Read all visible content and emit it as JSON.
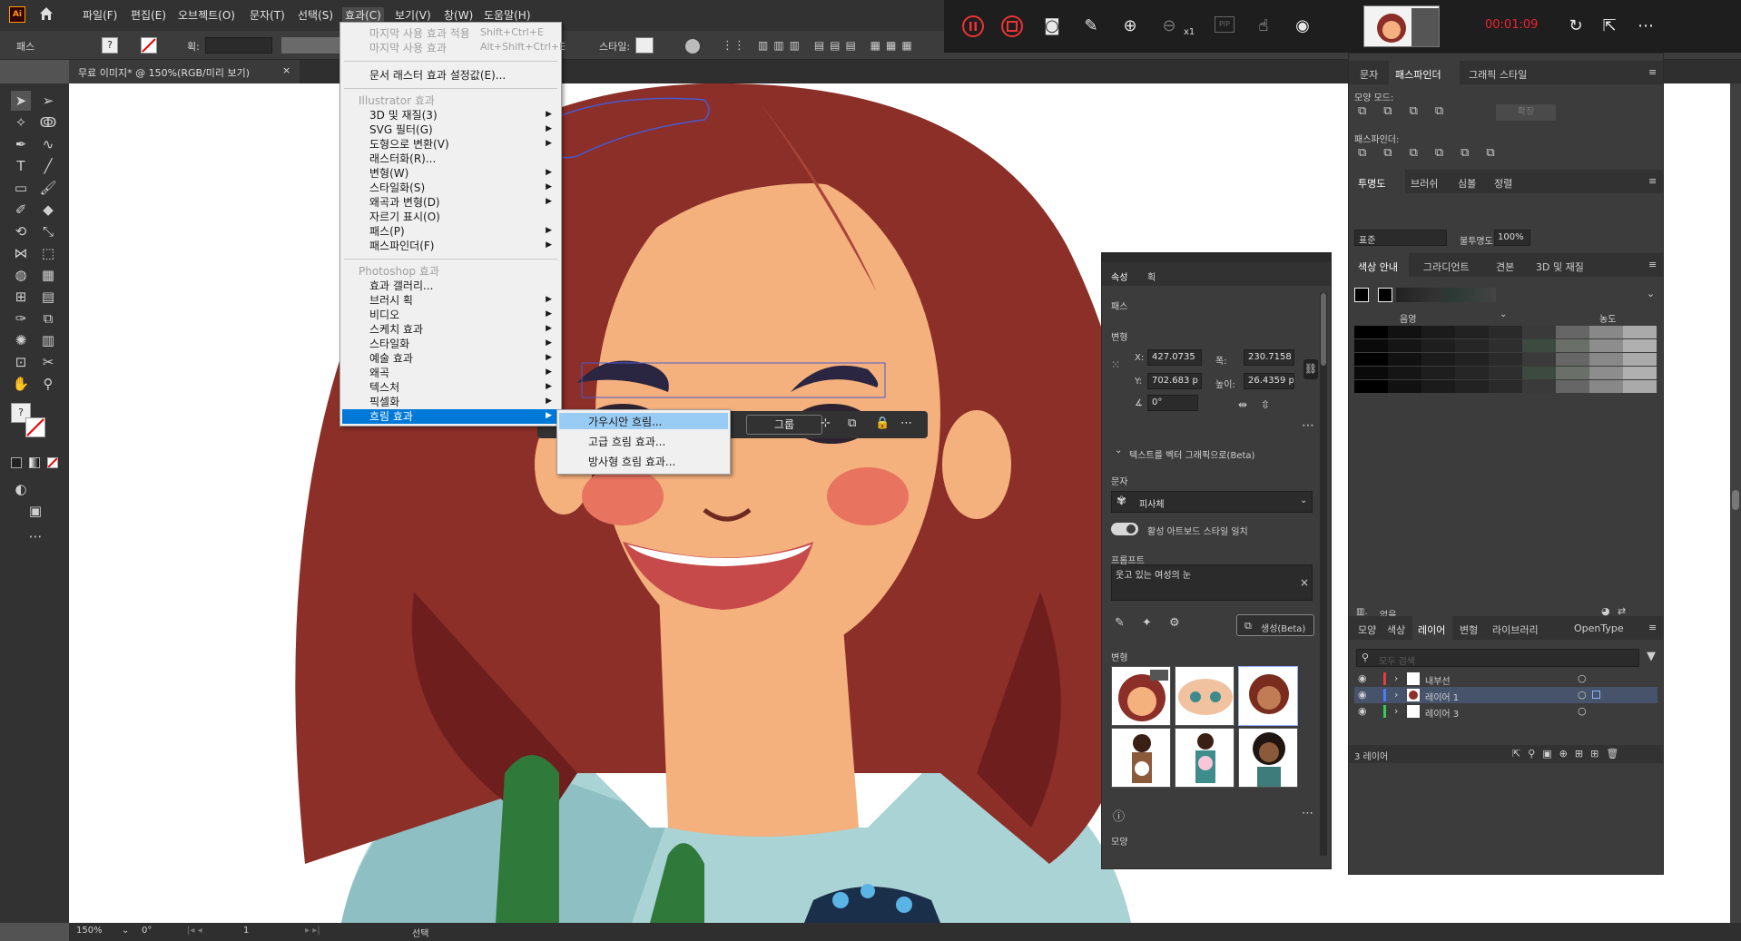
{
  "app": {
    "logo": "Ai"
  },
  "menubar": {
    "items": [
      "파일(F)",
      "편집(E)",
      "오브젝트(O)",
      "문자(T)",
      "선택(S)",
      "효과(C)",
      "보기(V)",
      "창(W)",
      "도움말(H)"
    ]
  },
  "control_bar": {
    "path_label": "패스",
    "stroke_label": "획:",
    "style_label": "스타일:"
  },
  "recorder": {
    "time": "00:01:09",
    "zoom_label": "x1",
    "pip": "PIP"
  },
  "document": {
    "tab_title": "무료 이미지* @ 150%(RGB/미리 보기)",
    "close": "×"
  },
  "effect_menu": {
    "last_apply": "마지막 사용 효과 적용",
    "last_apply_sc": "Shift+Ctrl+E",
    "last_used": "마지막 사용 효과",
    "last_used_sc": "Alt+Shift+Ctrl+E",
    "raster_settings": "문서 래스터 효과 설정값(E)...",
    "illustrator_header": "Illustrator 효과",
    "illustrator_items": [
      "3D 및 재질(3)",
      "SVG 필터(G)",
      "도형으로 변환(V)",
      "래스터화(R)...",
      "변형(W)",
      "스타일화(S)",
      "왜곡과 변형(D)",
      "자르기 표시(O)",
      "패스(P)",
      "패스파인더(F)"
    ],
    "photoshop_header": "Photoshop 효과",
    "photoshop_items": [
      "효과 갤러리...",
      "브러시 획",
      "비디오",
      "스케치 효과",
      "스타일화",
      "예술 효과",
      "왜곡",
      "텍스처",
      "픽셀화",
      "흐림 효과"
    ]
  },
  "blur_submenu": {
    "items": [
      "가우시안 흐림...",
      "고급 흐림 효과...",
      "방사형 흐림 효과..."
    ]
  },
  "context_bar": {
    "group_label": "그룹"
  },
  "properties": {
    "tabs": [
      "속성",
      "획"
    ],
    "path": "패스",
    "transform": "변형",
    "x_label": "X:",
    "x": "427.0735",
    "w_label": "폭:",
    "w": "230.7158",
    "y_label": "Y:",
    "y": "702.683 p",
    "h_label": "높이:",
    "h": "26.4359 p",
    "angle": "0°",
    "vectorize_title": "텍스트를 벡터 그래픽으로(Beta)",
    "type_label": "문자",
    "subject": "피사체",
    "toggle_label": "활성 아트보드 스타일 일치",
    "prompt_label": "프롬프트",
    "prompt": "웃고 있는 여성의 눈",
    "generate": "생성(Beta)",
    "variations": "변형",
    "appearance": "모양"
  },
  "right_panel": {
    "top_tabs": [
      "문자",
      "패스파인더",
      "그래픽 스타일"
    ],
    "shape_modes": "모양 모드:",
    "expand": "확장",
    "pathfinder": "패스파인더:",
    "trans_tabs": [
      "투명도",
      "브러쉬",
      "심볼",
      "정렬"
    ],
    "blend_mode": "표준",
    "opacity_label": "불투명도:",
    "opacity": "100%",
    "color_tabs": [
      "색상 안내",
      "그라디언트",
      "견본",
      "3D 및 재질"
    ],
    "shade_label": "음영",
    "tint_label": "농도",
    "none_label": "없음",
    "layer_tabs": [
      "모양",
      "색상",
      "레이어",
      "변형",
      "라이브러리",
      "OpenType"
    ],
    "search_placeholder": "모두 검색",
    "layers": [
      {
        "name": "내부선",
        "color": "#e04040"
      },
      {
        "name": "레이어 1",
        "color": "#4a7aff"
      },
      {
        "name": "레이어 3",
        "color": "#33cc55"
      }
    ],
    "layer_count": "3 레이어"
  },
  "status": {
    "zoom": "150%",
    "rotation": "0°",
    "artboard": "1",
    "tool": "선택"
  }
}
